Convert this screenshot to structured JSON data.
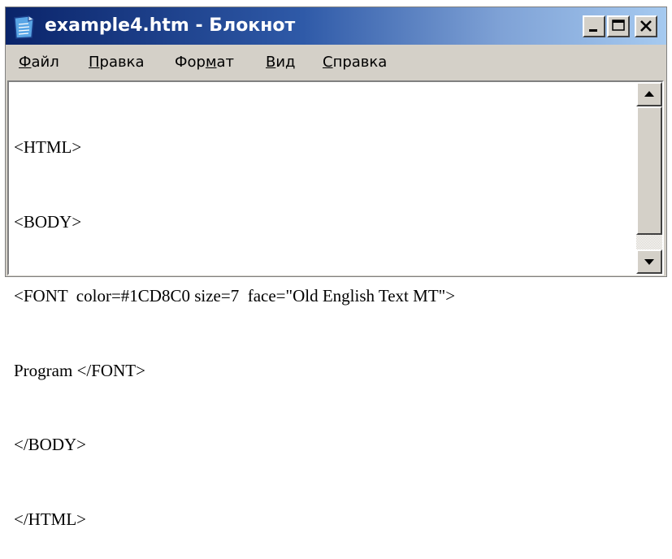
{
  "window": {
    "title": "example4.htm - Блокнот"
  },
  "menu": [
    {
      "pre": "",
      "ul": "Ф",
      "post": "айл"
    },
    {
      "pre": "",
      "ul": "П",
      "post": "равка"
    },
    {
      "pre": "Фор",
      "ul": "м",
      "post": "ат"
    },
    {
      "pre": "",
      "ul": "В",
      "post": "ид"
    },
    {
      "pre": "",
      "ul": "С",
      "post": "правка"
    }
  ],
  "editor": {
    "lines": [
      "<HTML>",
      "<BODY>",
      "<FONT  color=#1CD8C0 size=7  face=\"Old English Text MT\">",
      "Program </FONT>",
      "</BODY>",
      "</HTML>"
    ]
  },
  "icons": {
    "app": "notepad-icon",
    "minimize": "minimize-icon",
    "maximize": "maximize-icon",
    "close": "close-icon",
    "scroll_up": "arrow-up-icon",
    "scroll_down": "arrow-down-icon"
  },
  "colors": {
    "titlebar_start": "#0a246a",
    "titlebar_end": "#a6caf0",
    "chrome": "#d4d0c8"
  }
}
